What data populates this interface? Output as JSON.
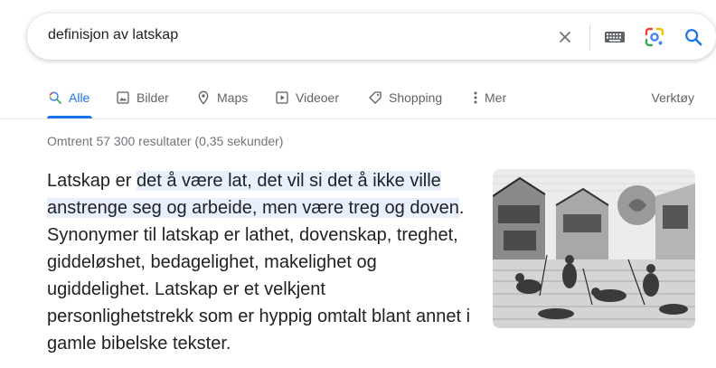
{
  "search": {
    "query": "definisjon av latskap",
    "icons": [
      "close-icon",
      "keyboard-icon",
      "lens-icon",
      "search-icon"
    ]
  },
  "tabs": [
    {
      "label": "Alle",
      "icon": "search-icon",
      "active": true
    },
    {
      "label": "Bilder",
      "icon": "image-icon"
    },
    {
      "label": "Maps",
      "icon": "map-pin-icon"
    },
    {
      "label": "Videoer",
      "icon": "play-icon"
    },
    {
      "label": "Shopping",
      "icon": "tag-icon"
    },
    {
      "label": "Mer",
      "icon": "more-vert-icon"
    }
  ],
  "tools_label": "Verktøy",
  "result_stats": "Omtrent 57 300 resultater (0,35 sekunder)",
  "snippet": {
    "part1": "Latskap er ",
    "highlight": "det å være lat, det vil si det å ikke ville anstrenge seg og arbeide, men være treg og doven",
    "part2": ". Synonymer til latskap er lathet, dovenskap, treghet, giddeløshet, bedagelighet, makelighet og ugiddelighet. Latskap er et velkjent personlighetstrekk som er hyppig omtalt blant annet i gamle bibelske tekster."
  },
  "colors": {
    "accent": "#1a73e8",
    "highlight": "#e8f0fe",
    "muted": "#5f6368"
  }
}
